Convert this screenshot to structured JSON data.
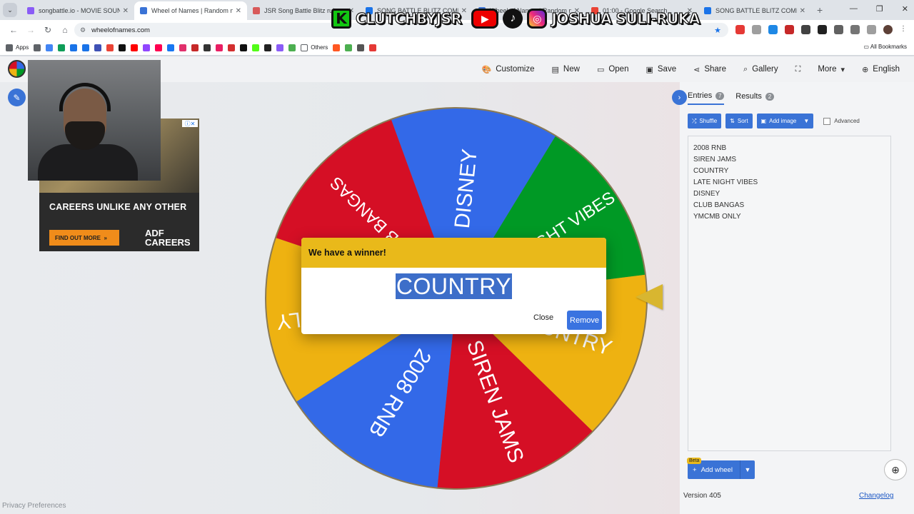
{
  "browser": {
    "tabs": [
      {
        "title": "songbattle.io - MOVIE SOUNDT",
        "color": "#8a5cf6",
        "active": false
      },
      {
        "title": "Wheel of Names | Random nam",
        "color": "#3a73d6",
        "active": true
      },
      {
        "title": "JSR Song Battle Blitz rules - Cl",
        "color": "#d85a5a",
        "active": false
      },
      {
        "title": "SONG BATTLE BLITZ COMP Pl",
        "color": "#1a73e8",
        "active": false
      },
      {
        "title": "Wheel of Names | Random nam",
        "color": "#3a73d6",
        "active": false
      },
      {
        "title": "01:00 - Google Search",
        "color": "#ea4335",
        "active": false
      },
      {
        "title": "SONG BATTLE BLITZ COMP - G",
        "color": "#1a73e8",
        "active": false
      }
    ],
    "url": "wheelofnames.com",
    "bookmarks_apps": "Apps",
    "bookmarks_others": "Others",
    "all_bookmarks": "All Bookmarks"
  },
  "stream_overlay": {
    "handle_1": "CLUTCHBYJSR",
    "handle_2": "JOSHUA SULI-RUKA"
  },
  "header": {
    "menu": [
      {
        "label": "Customize",
        "icon": "palette-icon"
      },
      {
        "label": "New",
        "icon": "file-icon"
      },
      {
        "label": "Open",
        "icon": "folder-icon"
      },
      {
        "label": "Save",
        "icon": "save-icon"
      },
      {
        "label": "Share",
        "icon": "share-icon"
      },
      {
        "label": "Gallery",
        "icon": "search-icon"
      },
      {
        "label": "",
        "icon": "fullscreen-icon"
      },
      {
        "label": "More",
        "icon": "chevron-down-icon"
      },
      {
        "label": "English",
        "icon": "globe-icon"
      }
    ]
  },
  "ad": {
    "tagline": "CAREERS UNLIKE ANY OTHER",
    "cta": "FIND OUT MORE",
    "brand_line1": "ADF",
    "brand_line2": "CAREERS"
  },
  "wheel": {
    "segments": [
      {
        "label": "DISNEY",
        "color": "#3369e8"
      },
      {
        "label": "LATE NIGHT VIBES",
        "color": "#009925"
      },
      {
        "label": "COUNTRY",
        "color": "#eeb211"
      },
      {
        "label": "SIREN JAMS",
        "color": "#d50f25"
      },
      {
        "label": "2008 RNB",
        "color": "#3369e8"
      },
      {
        "label": "YMCMB ONLY",
        "color": "#eeb211"
      },
      {
        "label": "CLUB BANGAS",
        "color": "#d50f25"
      }
    ]
  },
  "dialog": {
    "title": "We have a winner!",
    "winner": "COUNTRY",
    "close_label": "Close",
    "remove_label": "Remove"
  },
  "sidebar": {
    "tab_entries": "Entries",
    "entries_count": "7",
    "tab_results": "Results",
    "results_count": "2",
    "shuffle_label": "Shuffle",
    "sort_label": "Sort",
    "add_image_label": "Add image",
    "advanced_label": "Advanced",
    "entries": [
      "2008 RNB",
      "SIREN JAMS",
      "COUNTRY",
      "LATE NIGHT VIBES",
      "DISNEY",
      "CLUB BANGAS",
      "YMCMB ONLY"
    ],
    "beta_label": "Beta",
    "add_wheel_label": "Add wheel",
    "version": "Version 405",
    "changelog": "Changelog"
  },
  "footer": {
    "privacy": "Privacy Preferences"
  }
}
